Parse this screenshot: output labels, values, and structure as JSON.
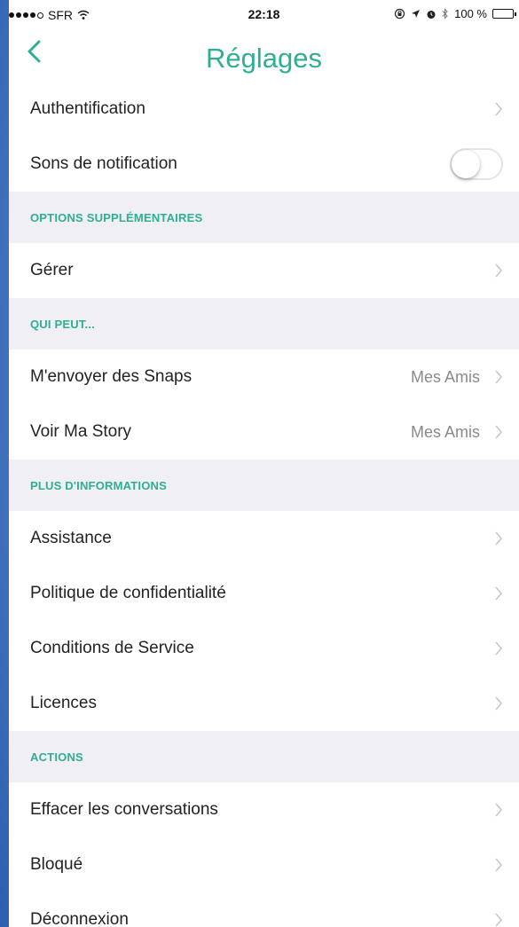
{
  "status_bar": {
    "carrier": "SFR",
    "time": "22:18",
    "battery": "100 %",
    "signal_icon": "signal-dots-icon",
    "wifi_icon": "wifi-icon",
    "right_icons": [
      "lock-rotation-icon",
      "location-arrow-icon",
      "alarm-icon",
      "bluetooth-icon",
      "battery-icon"
    ]
  },
  "nav": {
    "title": "Réglages",
    "back_icon": "chevron-left-icon"
  },
  "colors": {
    "accent": "#2eaf94",
    "section_background": "#efeff4",
    "value_text": "#8a8a8a"
  },
  "rows_top": [
    {
      "label": "Authentification"
    },
    {
      "label": "Sons de notification",
      "toggle_on": false
    }
  ],
  "sections": [
    {
      "header": "OPTIONS SUPPLÉMENTAIRES",
      "rows": [
        {
          "label": "Gérer"
        }
      ]
    },
    {
      "header": "QUI PEUT...",
      "rows": [
        {
          "label": "M'envoyer des Snaps",
          "value": "Mes Amis"
        },
        {
          "label": "Voir Ma Story",
          "value": "Mes Amis"
        }
      ]
    },
    {
      "header": "PLUS D'INFORMATIONS",
      "rows": [
        {
          "label": "Assistance"
        },
        {
          "label": "Politique de confidentialité"
        },
        {
          "label": "Conditions de Service"
        },
        {
          "label": "Licences"
        }
      ]
    },
    {
      "header": "ACTIONS",
      "rows": [
        {
          "label": "Effacer les conversations"
        },
        {
          "label": "Bloqué"
        },
        {
          "label": "Déconnexion"
        }
      ]
    }
  ]
}
